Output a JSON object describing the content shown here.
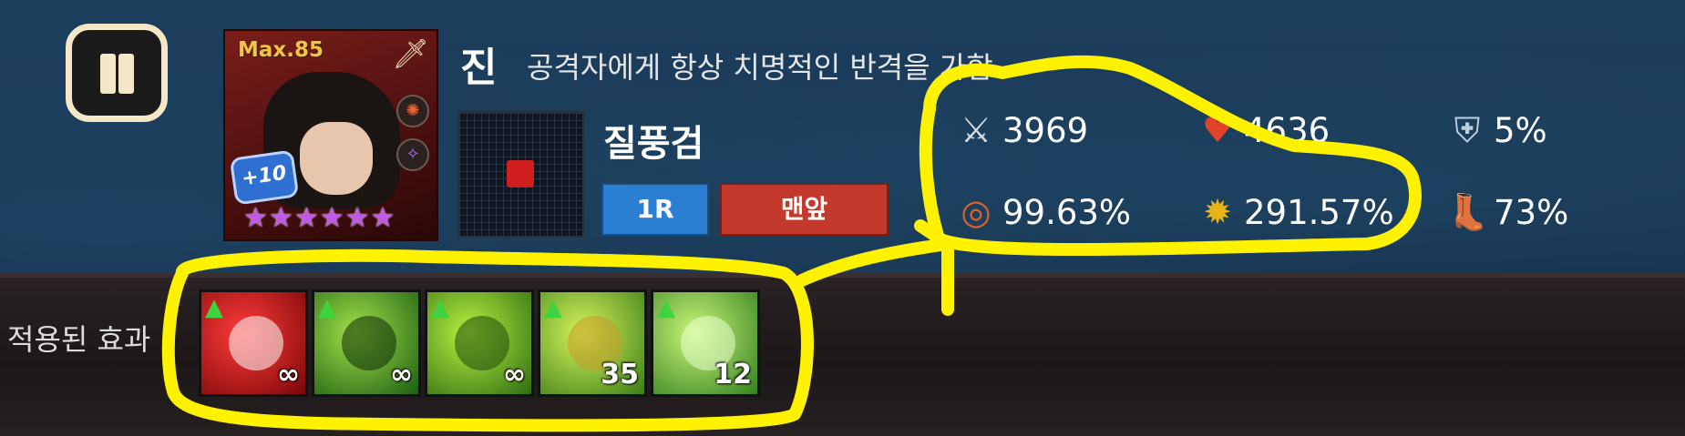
{
  "pause": {
    "icon": "pause-icon"
  },
  "hero": {
    "max_level": "Max.85",
    "enhance": "+10",
    "stars": [
      "★",
      "★",
      "★",
      "★",
      "★",
      "★"
    ],
    "name": "진",
    "description": "공격자에게 항상 치명적인 반격을 가함",
    "class_icon": "sword-icon"
  },
  "skill": {
    "name": "질풍검",
    "round": "1R",
    "position": "맨앞"
  },
  "stats": [
    {
      "icon": "attack-icon",
      "glyph": "⚔",
      "color": "#d8dde3",
      "value": "3969"
    },
    {
      "icon": "heart-icon",
      "glyph": "♥",
      "color": "#e0432a",
      "value": "4636"
    },
    {
      "icon": "shield-icon",
      "glyph": "⛨",
      "color": "#bcd0e0",
      "value": "5%"
    },
    {
      "icon": "accuracy-icon",
      "glyph": "◎",
      "color": "#d7622e",
      "value": "99.63%"
    },
    {
      "icon": "critical-icon",
      "glyph": "✹",
      "color": "#e8b417",
      "value": "291.57%"
    },
    {
      "icon": "boot-icon",
      "glyph": "👢",
      "color": "#b06a3a",
      "value": "73%"
    }
  ],
  "effects": {
    "label": "적용된 효과",
    "items": [
      {
        "name": "effect-critical-up",
        "count": "∞",
        "bg1": "#ff3b3b",
        "bg2": "#7a0707"
      },
      {
        "name": "effect-dino-up",
        "count": "∞",
        "bg1": "#9fe04a",
        "bg2": "#1f5e12"
      },
      {
        "name": "effect-body-up",
        "count": "∞",
        "bg1": "#b8f040",
        "bg2": "#2e6d12"
      },
      {
        "name": "effect-mirror-up",
        "count": "35",
        "bg1": "#d4f35a",
        "bg2": "#3c7d18"
      },
      {
        "name": "effect-blade-up",
        "count": "12",
        "bg1": "#c8f57a",
        "bg2": "#347f1e"
      }
    ]
  },
  "colors": {
    "annotation": "#fff200"
  }
}
